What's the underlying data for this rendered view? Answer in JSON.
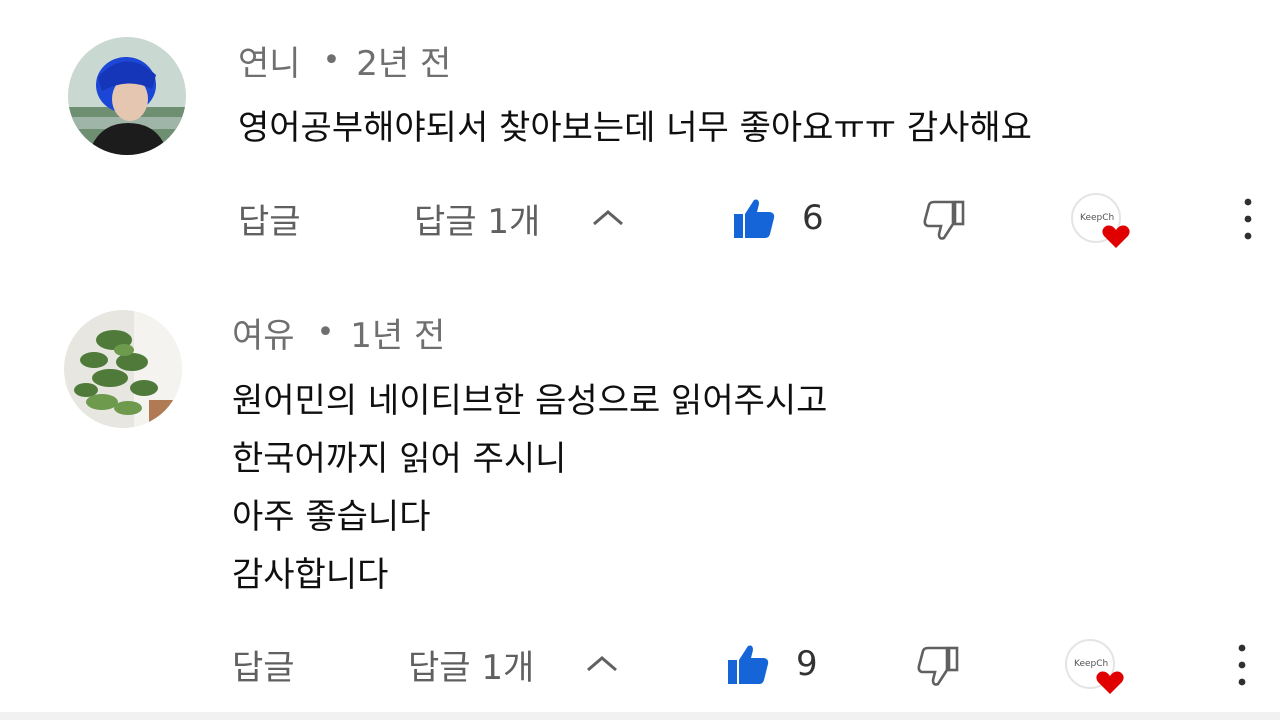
{
  "comments": [
    {
      "author": "연니",
      "separator": "•",
      "time": "2년 전",
      "lines": [
        "영어공부해야되서 찾아보는데 너무 좋아요ㅠㅠ 감사해요"
      ],
      "reply_label": "답글",
      "replies_label": "답글 1개",
      "likes": "6",
      "heart_badge_text": "KeepCh"
    },
    {
      "author": "여유",
      "separator": "•",
      "time": "1년 전",
      "lines": [
        "원어민의 네이티브한 음성으로 읽어주시고",
        "한국어까지 읽어 주시니",
        "아주 좋습니다",
        "감사합니다"
      ],
      "reply_label": "답글",
      "replies_label": "답글 1개",
      "likes": "9",
      "heart_badge_text": "KeepCh"
    }
  ],
  "colors": {
    "like_blue": "#1565d8",
    "heart_red": "#e00000",
    "meta_gray": "#6f6f6f"
  },
  "icons": [
    "thumbs-up-icon",
    "thumbs-down-icon",
    "chevron-up-icon",
    "heart-badge-icon",
    "more-vertical-icon"
  ]
}
